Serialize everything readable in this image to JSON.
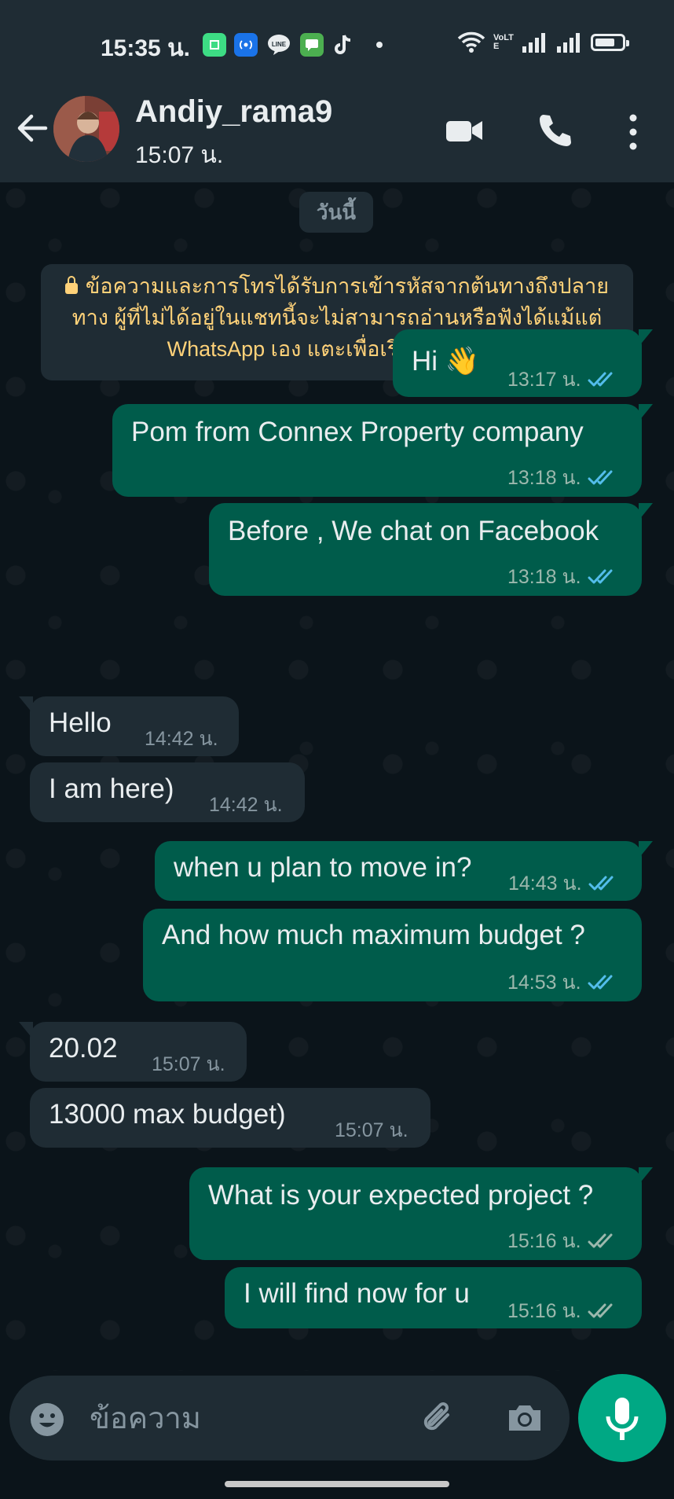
{
  "status_bar": {
    "time": "15:35 น.",
    "network_label": "VoLTE",
    "battery_level": 0.75
  },
  "header": {
    "contact_name": "Andiy_rama9",
    "contact_status": "15:07 น."
  },
  "chat": {
    "date_label": "วันนี้",
    "encryption_notice": "ข้อความและการโทรได้รับการเข้ารหัสจากต้นทางถึงปลายทาง ผู้ที่ไม่ได้อยู่ในแชทนี้จะไม่สามารถอ่านหรือฟังได้แม้แต่ WhatsApp เอง แตะเพื่อเรียนรู้เพิ่มเติม",
    "messages": [
      {
        "direction": "out",
        "text": "Hi 👋",
        "time": "13:17 น.",
        "status": "read"
      },
      {
        "direction": "out",
        "text": "Pom from Connex Property company",
        "time": "13:18 น.",
        "status": "read"
      },
      {
        "direction": "out",
        "text": "Before , We chat on Facebook",
        "time": "13:18 น.",
        "status": "read"
      },
      {
        "direction": "in",
        "text": "Hello",
        "time": "14:42 น."
      },
      {
        "direction": "in",
        "text": "I am here)",
        "time": "14:42 น."
      },
      {
        "direction": "out",
        "text": "when u plan to move in?",
        "time": "14:43 น.",
        "status": "read"
      },
      {
        "direction": "out",
        "text": "And how much maximum budget ?",
        "time": "14:53 น.",
        "status": "read"
      },
      {
        "direction": "in",
        "text": "20.02",
        "time": "15:07 น."
      },
      {
        "direction": "in",
        "text": "13000 max budget)",
        "time": "15:07 น."
      },
      {
        "direction": "out",
        "text": "What is your expected project ?",
        "time": "15:16 น.",
        "status": "delivered"
      },
      {
        "direction": "out",
        "text": "I will find now for u",
        "time": "15:16 น.",
        "status": "delivered"
      }
    ]
  },
  "composer": {
    "placeholder": "ข้อความ"
  },
  "colors": {
    "outgoing_bubble": "#005c4b",
    "incoming_bubble": "#1f2c34",
    "accent": "#00a884",
    "read_ticks": "#53bdeb",
    "notice_text": "#ffd279"
  }
}
